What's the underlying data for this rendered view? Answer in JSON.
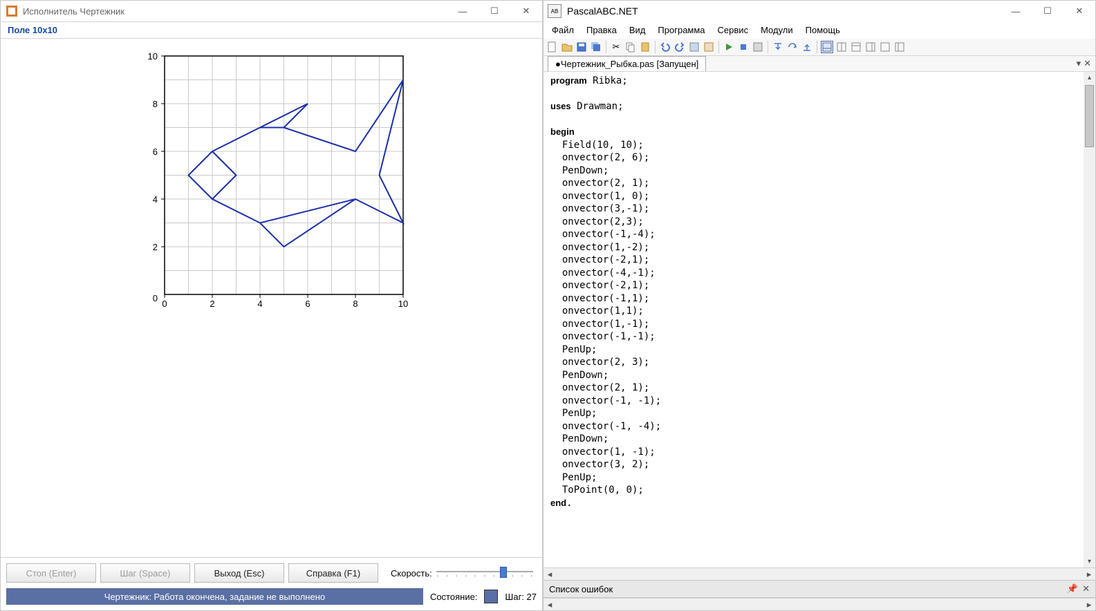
{
  "left_window": {
    "title": "Исполнитель Чертежник",
    "field_label": "Поле  10x10",
    "buttons": {
      "stop": "Стоп (Enter)",
      "step": "Шаг (Space)",
      "exit": "Выход (Esc)",
      "help": "Справка (F1)"
    },
    "speed_label": "Скорость:",
    "status_text": "Чертежник: Работа окончена, задание не выполнено",
    "state_label": "Состояние:",
    "step_label": "Шаг: 27"
  },
  "chart_data": {
    "type": "line",
    "title": "",
    "xlabel": "",
    "ylabel": "",
    "xlim": [
      0,
      10
    ],
    "ylim": [
      0,
      10
    ],
    "x_ticks": [
      0,
      2,
      4,
      6,
      8,
      10
    ],
    "y_ticks": [
      2,
      4,
      6,
      8,
      10
    ],
    "segments": [
      {
        "pts": [
          [
            2,
            6
          ],
          [
            4,
            7
          ],
          [
            5,
            7
          ],
          [
            8,
            6
          ],
          [
            10,
            9
          ],
          [
            9,
            5
          ],
          [
            10,
            3
          ],
          [
            8,
            4
          ],
          [
            4,
            3
          ],
          [
            2,
            4
          ],
          [
            1,
            5
          ],
          [
            2,
            6
          ]
        ]
      },
      {
        "pts": [
          [
            2,
            6
          ],
          [
            3,
            5
          ],
          [
            2,
            4
          ]
        ]
      },
      {
        "pts": [
          [
            4,
            7
          ],
          [
            6,
            8
          ],
          [
            5,
            7
          ]
        ]
      },
      {
        "pts": [
          [
            4,
            3
          ],
          [
            5,
            2
          ],
          [
            8,
            4
          ]
        ]
      }
    ]
  },
  "ide": {
    "title": "PascalABC.NET",
    "menu": [
      "Файл",
      "Правка",
      "Вид",
      "Программа",
      "Сервис",
      "Модули",
      "Помощь"
    ],
    "tab": "●Чертежник_Рыбка.pas [Запущен]",
    "errors_title": "Список ошибок",
    "code_lines": [
      {
        "t": "kw",
        "v": "program"
      },
      {
        "t": "sp"
      },
      {
        "t": "p",
        "v": "Ribka;"
      },
      {
        "t": "br"
      },
      {
        "t": "br"
      },
      {
        "t": "kw",
        "v": "uses"
      },
      {
        "t": "sp"
      },
      {
        "t": "p",
        "v": "Drawman;"
      },
      {
        "t": "br"
      },
      {
        "t": "br"
      },
      {
        "t": "kw",
        "v": "begin"
      },
      {
        "t": "br"
      },
      {
        "t": "ind"
      },
      {
        "t": "p",
        "v": "Field(10, 10);"
      },
      {
        "t": "br"
      },
      {
        "t": "ind"
      },
      {
        "t": "p",
        "v": "onvector(2, 6);"
      },
      {
        "t": "br"
      },
      {
        "t": "ind"
      },
      {
        "t": "p",
        "v": "PenDown;"
      },
      {
        "t": "br"
      },
      {
        "t": "ind"
      },
      {
        "t": "p",
        "v": "onvector(2, 1);"
      },
      {
        "t": "br"
      },
      {
        "t": "ind"
      },
      {
        "t": "p",
        "v": "onvector(1, 0);"
      },
      {
        "t": "br"
      },
      {
        "t": "ind"
      },
      {
        "t": "p",
        "v": "onvector(3,-1);"
      },
      {
        "t": "br"
      },
      {
        "t": "ind"
      },
      {
        "t": "p",
        "v": "onvector(2,3);"
      },
      {
        "t": "br"
      },
      {
        "t": "ind"
      },
      {
        "t": "p",
        "v": "onvector(-1,-4);"
      },
      {
        "t": "br"
      },
      {
        "t": "ind"
      },
      {
        "t": "p",
        "v": "onvector(1,-2);"
      },
      {
        "t": "br"
      },
      {
        "t": "ind"
      },
      {
        "t": "p",
        "v": "onvector(-2,1);"
      },
      {
        "t": "br"
      },
      {
        "t": "ind"
      },
      {
        "t": "p",
        "v": "onvector(-4,-1);"
      },
      {
        "t": "br"
      },
      {
        "t": "ind"
      },
      {
        "t": "p",
        "v": "onvector(-2,1);"
      },
      {
        "t": "br"
      },
      {
        "t": "ind"
      },
      {
        "t": "p",
        "v": "onvector(-1,1);"
      },
      {
        "t": "br"
      },
      {
        "t": "ind"
      },
      {
        "t": "p",
        "v": "onvector(1,1);"
      },
      {
        "t": "br"
      },
      {
        "t": "ind"
      },
      {
        "t": "p",
        "v": "onvector(1,-1);"
      },
      {
        "t": "br"
      },
      {
        "t": "ind"
      },
      {
        "t": "p",
        "v": "onvector(-1,-1);"
      },
      {
        "t": "br"
      },
      {
        "t": "ind"
      },
      {
        "t": "p",
        "v": "PenUp;"
      },
      {
        "t": "br"
      },
      {
        "t": "ind"
      },
      {
        "t": "p",
        "v": "onvector(2, 3);"
      },
      {
        "t": "br"
      },
      {
        "t": "ind"
      },
      {
        "t": "p",
        "v": "PenDown;"
      },
      {
        "t": "br"
      },
      {
        "t": "ind"
      },
      {
        "t": "p",
        "v": "onvector(2, 1);"
      },
      {
        "t": "br"
      },
      {
        "t": "ind"
      },
      {
        "t": "p",
        "v": "onvector(-1, -1);"
      },
      {
        "t": "br"
      },
      {
        "t": "ind"
      },
      {
        "t": "p",
        "v": "PenUp;"
      },
      {
        "t": "br"
      },
      {
        "t": "ind"
      },
      {
        "t": "p",
        "v": "onvector(-1, -4);"
      },
      {
        "t": "br"
      },
      {
        "t": "ind"
      },
      {
        "t": "p",
        "v": "PenDown;"
      },
      {
        "t": "br"
      },
      {
        "t": "ind"
      },
      {
        "t": "p",
        "v": "onvector(1, -1);"
      },
      {
        "t": "br"
      },
      {
        "t": "ind"
      },
      {
        "t": "p",
        "v": "onvector(3, 2);"
      },
      {
        "t": "br"
      },
      {
        "t": "ind"
      },
      {
        "t": "p",
        "v": "PenUp;"
      },
      {
        "t": "br"
      },
      {
        "t": "ind"
      },
      {
        "t": "p",
        "v": "ToPoint(0, 0);"
      },
      {
        "t": "br"
      },
      {
        "t": "kw",
        "v": "end"
      },
      {
        "t": "p",
        "v": "."
      }
    ]
  }
}
